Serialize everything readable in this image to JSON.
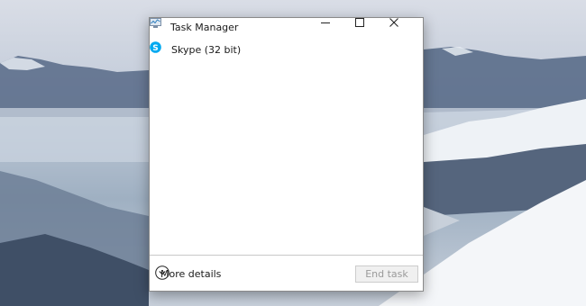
{
  "window": {
    "title": "Task Manager",
    "controls": {
      "minimize": "minimize-icon",
      "maximize": "maximize-icon",
      "close": "close-icon"
    }
  },
  "processes": [
    {
      "name": "Skype (32 bit)",
      "icon": "skype-icon",
      "icon_color": "#00a9f0"
    }
  ],
  "footer": {
    "more_details_label": "More details",
    "end_task_label": "End task",
    "end_task_enabled": false
  },
  "colors": {
    "window_bg": "#ffffff",
    "disabled_text": "#9a9a9a",
    "skype_blue": "#00a9f0"
  }
}
